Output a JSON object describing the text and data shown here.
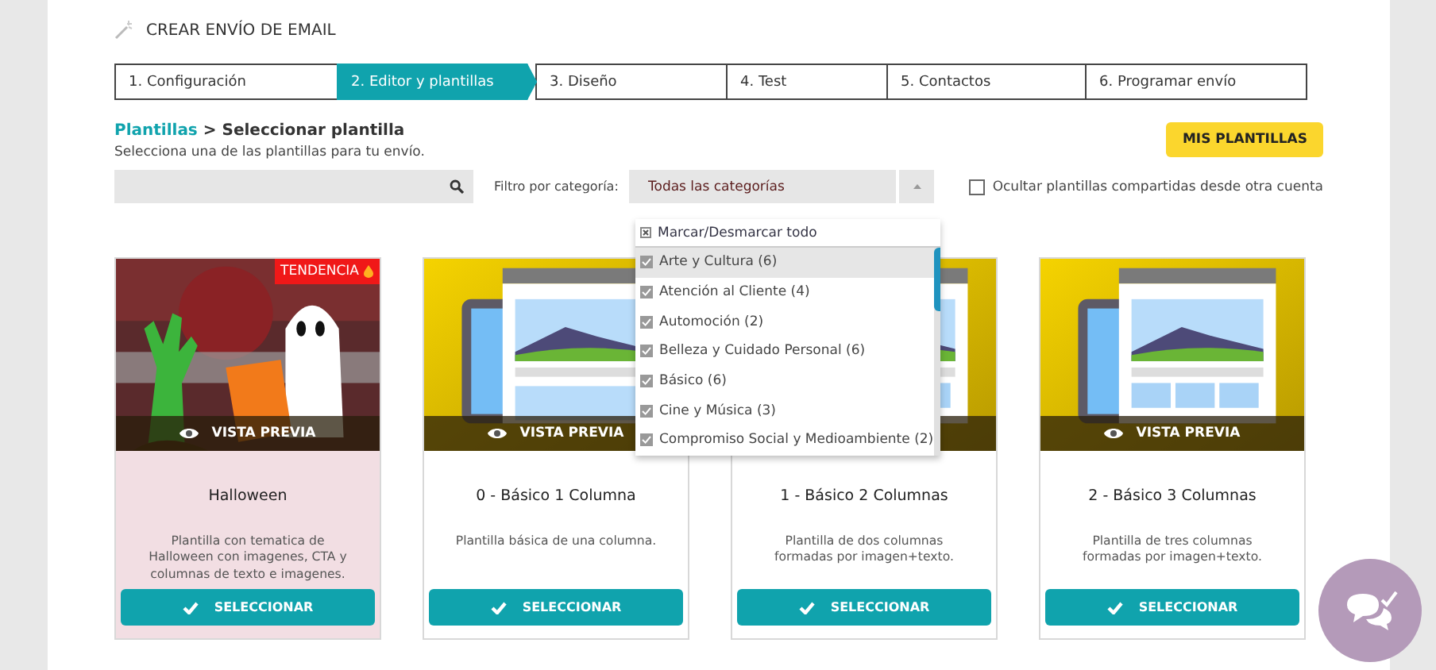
{
  "header": {
    "title": "CREAR ENVÍO DE EMAIL"
  },
  "steps": [
    {
      "label": "1. Configuración",
      "selected": false
    },
    {
      "label": "2. Editor y plantillas",
      "selected": true
    },
    {
      "label": "3. Diseño",
      "selected": false
    },
    {
      "label": "4. Test",
      "selected": false
    },
    {
      "label": "5. Contactos",
      "selected": false
    },
    {
      "label": "6. Programar envío",
      "selected": false
    }
  ],
  "breadcrumb": {
    "link": "Plantillas",
    "separator": ">",
    "current": "Seleccionar plantilla"
  },
  "subtitle": "Selecciona una de las plantillas para tu envío.",
  "my_templates_button": "MIS PLANTILLAS",
  "filter": {
    "label": "Filtro por categoría:",
    "value": "Todas las categorías",
    "toggle_all": "Marcar/Desmarcar todo",
    "options": [
      {
        "label": "Arte y Cultura (6)",
        "checked": true,
        "selected": true
      },
      {
        "label": "Atención al Cliente (4)",
        "checked": true,
        "selected": false
      },
      {
        "label": "Automoción (2)",
        "checked": true,
        "selected": false
      },
      {
        "label": "Belleza y Cuidado Personal (6)",
        "checked": true,
        "selected": false
      },
      {
        "label": "Básico (6)",
        "checked": true,
        "selected": false
      },
      {
        "label": "Cine y Música (3)",
        "checked": true,
        "selected": false
      },
      {
        "label": "Compromiso Social y Medioambiente (2)",
        "checked": true,
        "selected": false
      }
    ]
  },
  "hide_shared": {
    "label": "Ocultar plantillas compartidas desde otra cuenta",
    "checked": false
  },
  "cards": [
    {
      "title": "Halloween",
      "badge": "TENDENCIA",
      "preview": "VISTA PREVIA",
      "description": "Plantilla con tematica de Halloween con imagenes, CTA y columnas de texto e imagenes.",
      "button": "SELECCIONAR"
    },
    {
      "title": "0 - Básico 1 Columna",
      "preview": "VISTA PREVIA",
      "description": "Plantilla básica de una columna.",
      "button": "SELECCIONAR"
    },
    {
      "title": "1 - Básico 2 Columnas",
      "description": "Plantilla de dos columnas formadas por imagen+texto.",
      "button": "SELECCIONAR"
    },
    {
      "title": "2 - Básico 3 Columnas",
      "preview": "VISTA PREVIA",
      "description": "Plantilla de tres columnas formadas por imagen+texto.",
      "button": "SELECCIONAR"
    }
  ]
}
